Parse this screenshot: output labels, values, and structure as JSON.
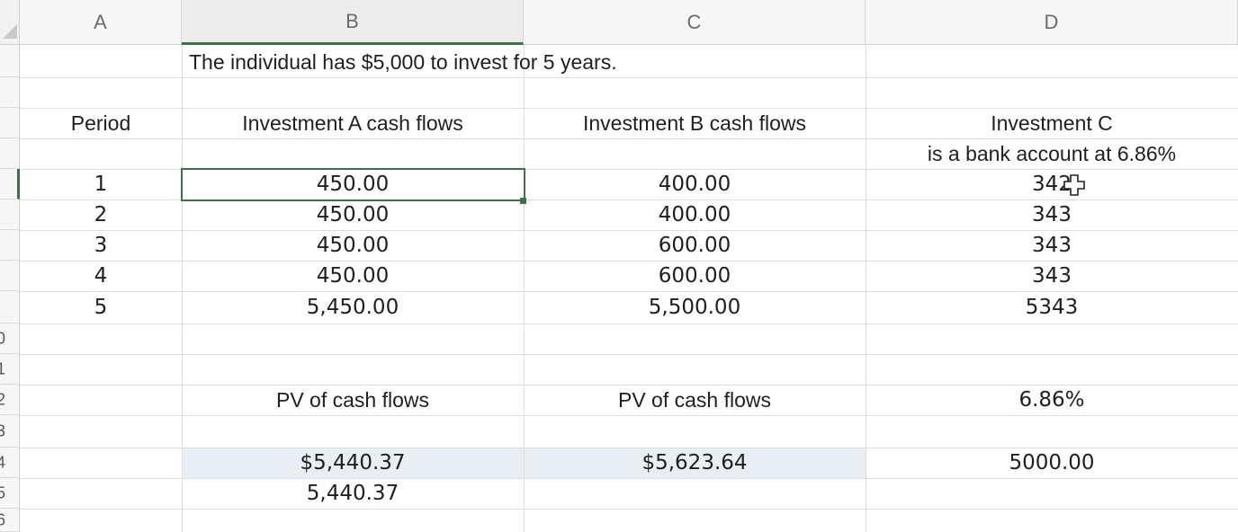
{
  "columns": [
    "A",
    "B",
    "C",
    "D"
  ],
  "row_numbers": [
    "0",
    "1",
    "2",
    "3",
    "4",
    "5",
    "6"
  ],
  "header_note": "The individual has $5,000 to invest for 5 years.",
  "table_headers": {
    "period": "Period",
    "inv_a": "Investment A cash flows",
    "inv_b": "Investment B cash flows",
    "inv_c_line1": "Investment C",
    "inv_c_line2": "is a bank account at 6.86%"
  },
  "rows": [
    {
      "period": "1",
      "a": "450.00",
      "b": "400.00",
      "c": "342"
    },
    {
      "period": "2",
      "a": "450.00",
      "b": "400.00",
      "c": "343"
    },
    {
      "period": "3",
      "a": "450.00",
      "b": "600.00",
      "c": "343"
    },
    {
      "period": "4",
      "a": "450.00",
      "b": "600.00",
      "c": "343"
    },
    {
      "period": "5",
      "a": "5,450.00",
      "b": "5,500.00",
      "c": "5343"
    }
  ],
  "pv_labels": {
    "b": "PV of cash flows",
    "c": "PV of cash flows",
    "d": "6.86%"
  },
  "pv_values": {
    "b": "$5,440.37",
    "c": "$5,623.64",
    "d": "5000.00"
  },
  "pv_value_b_plain": "5,440.37",
  "colors": {
    "accent": "#3f6e4b",
    "shade": "#e8eef2"
  },
  "cursor_icon": "plus-cursor-icon"
}
